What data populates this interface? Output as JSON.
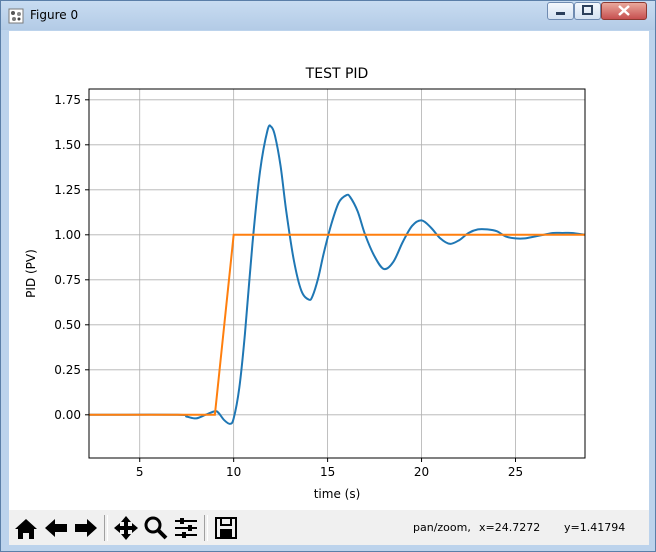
{
  "window": {
    "title": "Figure 0"
  },
  "toolbar": {
    "mode_label": "pan/zoom,",
    "x_readout": "x=24.7272",
    "y_readout": "y=1.41794",
    "buttons": [
      "home-icon",
      "back-arrow-icon",
      "forward-arrow-icon",
      "pan-move-icon",
      "zoom-magnifier-icon",
      "configure-subplots-icon",
      "save-floppy-icon"
    ]
  },
  "chart_data": {
    "type": "line",
    "title": "TEST PID",
    "xlabel": "time (s)",
    "ylabel": "PID (PV)",
    "xlim": [
      2.3,
      28.7
    ],
    "ylim": [
      -0.24,
      1.81
    ],
    "xticks": [
      "5",
      "10",
      "15",
      "20",
      "25"
    ],
    "yticks": [
      "0.00",
      "0.25",
      "0.50",
      "0.75",
      "1.00",
      "1.25",
      "1.50",
      "1.75"
    ],
    "xtick_values": [
      5,
      10,
      15,
      20,
      25
    ],
    "ytick_values": [
      0.0,
      0.25,
      0.5,
      0.75,
      1.0,
      1.25,
      1.5,
      1.75
    ],
    "grid": true,
    "series": [
      {
        "color": "#1f77b4",
        "x": [
          2.3,
          7.0,
          7.5,
          8.0,
          8.5,
          9.0,
          9.2,
          9.5,
          9.8,
          10.0,
          10.3,
          10.6,
          11.0,
          11.4,
          11.8,
          12.0,
          12.2,
          12.5,
          12.8,
          13.2,
          13.6,
          14.0,
          14.2,
          14.5,
          14.8,
          15.2,
          15.6,
          16.0,
          16.2,
          16.6,
          17.0,
          17.5,
          18.0,
          18.5,
          19.0,
          19.5,
          20.0,
          20.5,
          21.0,
          21.5,
          22.0,
          22.5,
          23.0,
          23.5,
          24.0,
          24.5,
          25.0,
          25.5,
          26.0,
          26.5,
          27.0,
          27.5,
          28.0,
          28.7
        ],
        "y": [
          0.0,
          0.0,
          -0.01,
          -0.02,
          0.0,
          0.02,
          0.01,
          -0.03,
          -0.05,
          -0.02,
          0.15,
          0.45,
          0.95,
          1.35,
          1.58,
          1.6,
          1.55,
          1.38,
          1.13,
          0.86,
          0.69,
          0.64,
          0.66,
          0.76,
          0.9,
          1.06,
          1.18,
          1.22,
          1.21,
          1.13,
          1.0,
          0.88,
          0.81,
          0.85,
          0.96,
          1.05,
          1.08,
          1.04,
          0.98,
          0.95,
          0.97,
          1.01,
          1.03,
          1.03,
          1.02,
          0.99,
          0.98,
          0.98,
          0.99,
          1.0,
          1.01,
          1.01,
          1.01,
          1.0
        ]
      },
      {
        "color": "#ff7f0e",
        "x": [
          2.3,
          9.0,
          10.0,
          28.7
        ],
        "y": [
          0.0,
          0.0,
          1.0,
          1.0
        ]
      }
    ]
  }
}
